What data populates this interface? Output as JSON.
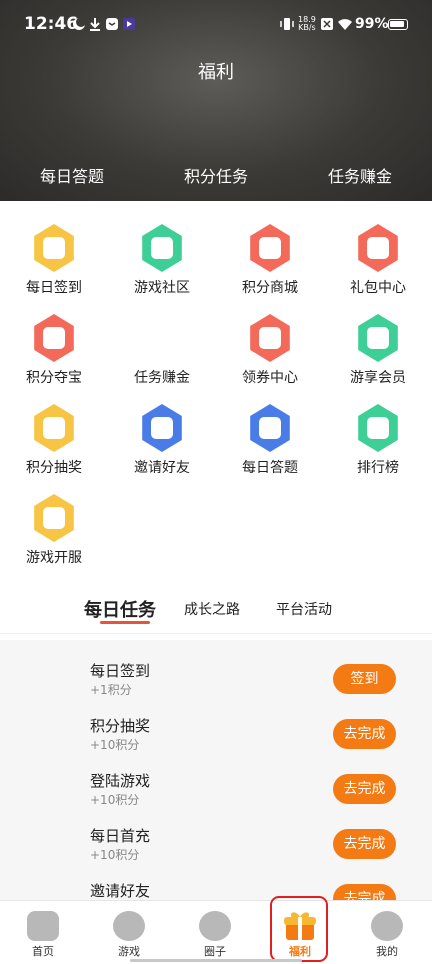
{
  "status_bar": {
    "time": "12:46",
    "speed": "18.9\nKB/s",
    "battery": "99%"
  },
  "header": {
    "title": "福利",
    "tabs": [
      {
        "label": "每日答题"
      },
      {
        "label": "积分任务"
      },
      {
        "label": "任务赚金"
      }
    ]
  },
  "grid": [
    {
      "label": "每日签到",
      "color": "#f7c443",
      "icon": "calendar-check-icon"
    },
    {
      "label": "游戏社区",
      "color": "#3dcf95",
      "icon": "chat-icon"
    },
    {
      "label": "积分商城",
      "color": "#f36a5a",
      "icon": "shopping-bag-icon"
    },
    {
      "label": "礼包中心",
      "color": "#f36a5a",
      "icon": "gift-box-icon"
    },
    {
      "label": "积分夺宝",
      "color": "#f36a5a",
      "icon": "treasure-icon"
    },
    {
      "label": "任务赚金",
      "color": "",
      "icon": ""
    },
    {
      "label": "领券中心",
      "color": "#f36a5a",
      "icon": "coupon-icon"
    },
    {
      "label": "游享会员",
      "color": "#3dcf95",
      "icon": "diamond-icon"
    },
    {
      "label": "积分抽奖",
      "color": "#f7c443",
      "icon": "coin-stack-icon"
    },
    {
      "label": "邀请好友",
      "color": "#4a7ce8",
      "icon": "envelope-icon"
    },
    {
      "label": "每日答题",
      "color": "#4a7ce8",
      "icon": "clipboard-icon"
    },
    {
      "label": "排行榜",
      "color": "#3dcf95",
      "icon": "trophy-icon"
    },
    {
      "label": "游戏开服",
      "color": "#f7c443",
      "icon": "server-calendar-icon"
    }
  ],
  "task_tabs": [
    {
      "label": "每日任务"
    },
    {
      "label": "成长之路"
    },
    {
      "label": "平台活动"
    }
  ],
  "tasks": [
    {
      "name": "每日签到",
      "reward": "+1积分",
      "button": "签到"
    },
    {
      "name": "积分抽奖",
      "reward": "+10积分",
      "button": "去完成"
    },
    {
      "name": "登陆游戏",
      "reward": "+10积分",
      "button": "去完成"
    },
    {
      "name": "每日首充",
      "reward": "+10积分",
      "button": "去完成"
    },
    {
      "name": "邀请好友",
      "reward": "",
      "button": "去完成"
    }
  ],
  "bottom_nav": [
    {
      "label": "首页",
      "icon": "gamepad-icon"
    },
    {
      "label": "游戏",
      "icon": "heart-bubble-icon"
    },
    {
      "label": "圈子",
      "icon": "circle-chat-icon"
    },
    {
      "label": "福利",
      "icon": "gift-icon"
    },
    {
      "label": "我的",
      "icon": "sunglasses-icon"
    }
  ],
  "colors": {
    "accent": "#f47a14",
    "tab_underline": "#e8543a",
    "highlight": "#e02020"
  }
}
